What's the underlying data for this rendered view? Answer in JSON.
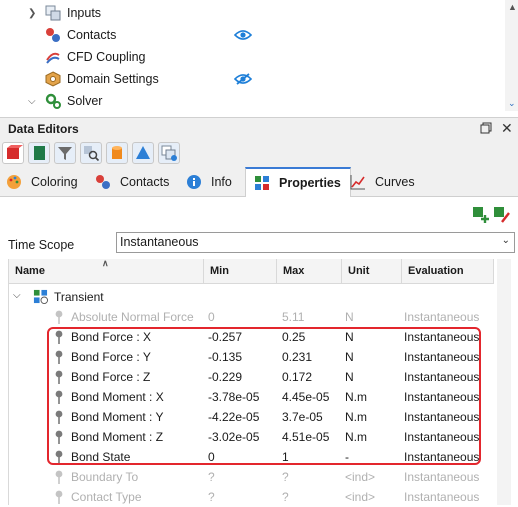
{
  "tree": {
    "items": [
      {
        "label": "Inputs",
        "icon": "inputs-icon"
      },
      {
        "label": "Contacts",
        "icon": "contacts-icon"
      },
      {
        "label": "CFD Coupling",
        "icon": "cfd-coupling-icon"
      },
      {
        "label": "Domain Settings",
        "icon": "domain-settings-icon"
      },
      {
        "label": "Solver",
        "icon": "solver-icon"
      }
    ]
  },
  "data_editors": {
    "title": "Data Editors",
    "tabs": [
      {
        "label": "Coloring",
        "icon": "palette-icon"
      },
      {
        "label": "Contacts",
        "icon": "contacts-icon"
      },
      {
        "label": "Info",
        "icon": "info-icon"
      },
      {
        "label": "Properties",
        "icon": "properties-icon",
        "active": true
      },
      {
        "label": "Curves",
        "icon": "curves-icon"
      }
    ],
    "time_scope": {
      "label": "Time Scope",
      "value": "Instantaneous"
    },
    "grid": {
      "columns": [
        "Name",
        "Min",
        "Max",
        "Unit",
        "Evaluation"
      ],
      "group": "Transient",
      "rows": [
        {
          "name": "Absolute Normal Force",
          "min": "0",
          "max": "5.11",
          "unit": "N",
          "evaluation": "Instantaneous",
          "faded": true
        },
        {
          "name": "Bond Force : X",
          "min": "-0.257",
          "max": "0.25",
          "unit": "N",
          "evaluation": "Instantaneous"
        },
        {
          "name": "Bond Force : Y",
          "min": "-0.135",
          "max": "0.231",
          "unit": "N",
          "evaluation": "Instantaneous"
        },
        {
          "name": "Bond Force : Z",
          "min": "-0.229",
          "max": "0.172",
          "unit": "N",
          "evaluation": "Instantaneous"
        },
        {
          "name": "Bond Moment : X",
          "min": "-3.78e-05",
          "max": "4.45e-05",
          "unit": "N.m",
          "evaluation": "Instantaneous"
        },
        {
          "name": "Bond Moment : Y",
          "min": "-4.22e-05",
          "max": "3.7e-05",
          "unit": "N.m",
          "evaluation": "Instantaneous"
        },
        {
          "name": "Bond Moment : Z",
          "min": "-3.02e-05",
          "max": "4.51e-05",
          "unit": "N.m",
          "evaluation": "Instantaneous"
        },
        {
          "name": "Bond State",
          "min": "0",
          "max": "1",
          "unit": "-",
          "evaluation": "Instantaneous"
        },
        {
          "name": "Boundary To",
          "min": "?",
          "max": "?",
          "unit": "<ind>",
          "evaluation": "Instantaneous",
          "faded": true
        },
        {
          "name": "Contact Type",
          "min": "?",
          "max": "?",
          "unit": "<ind>",
          "evaluation": "Instantaneous",
          "faded": true
        }
      ]
    }
  },
  "colors": {
    "accent": "#3a7bd5",
    "highlight": "#e3262d",
    "eye": "#1e7fd8"
  }
}
